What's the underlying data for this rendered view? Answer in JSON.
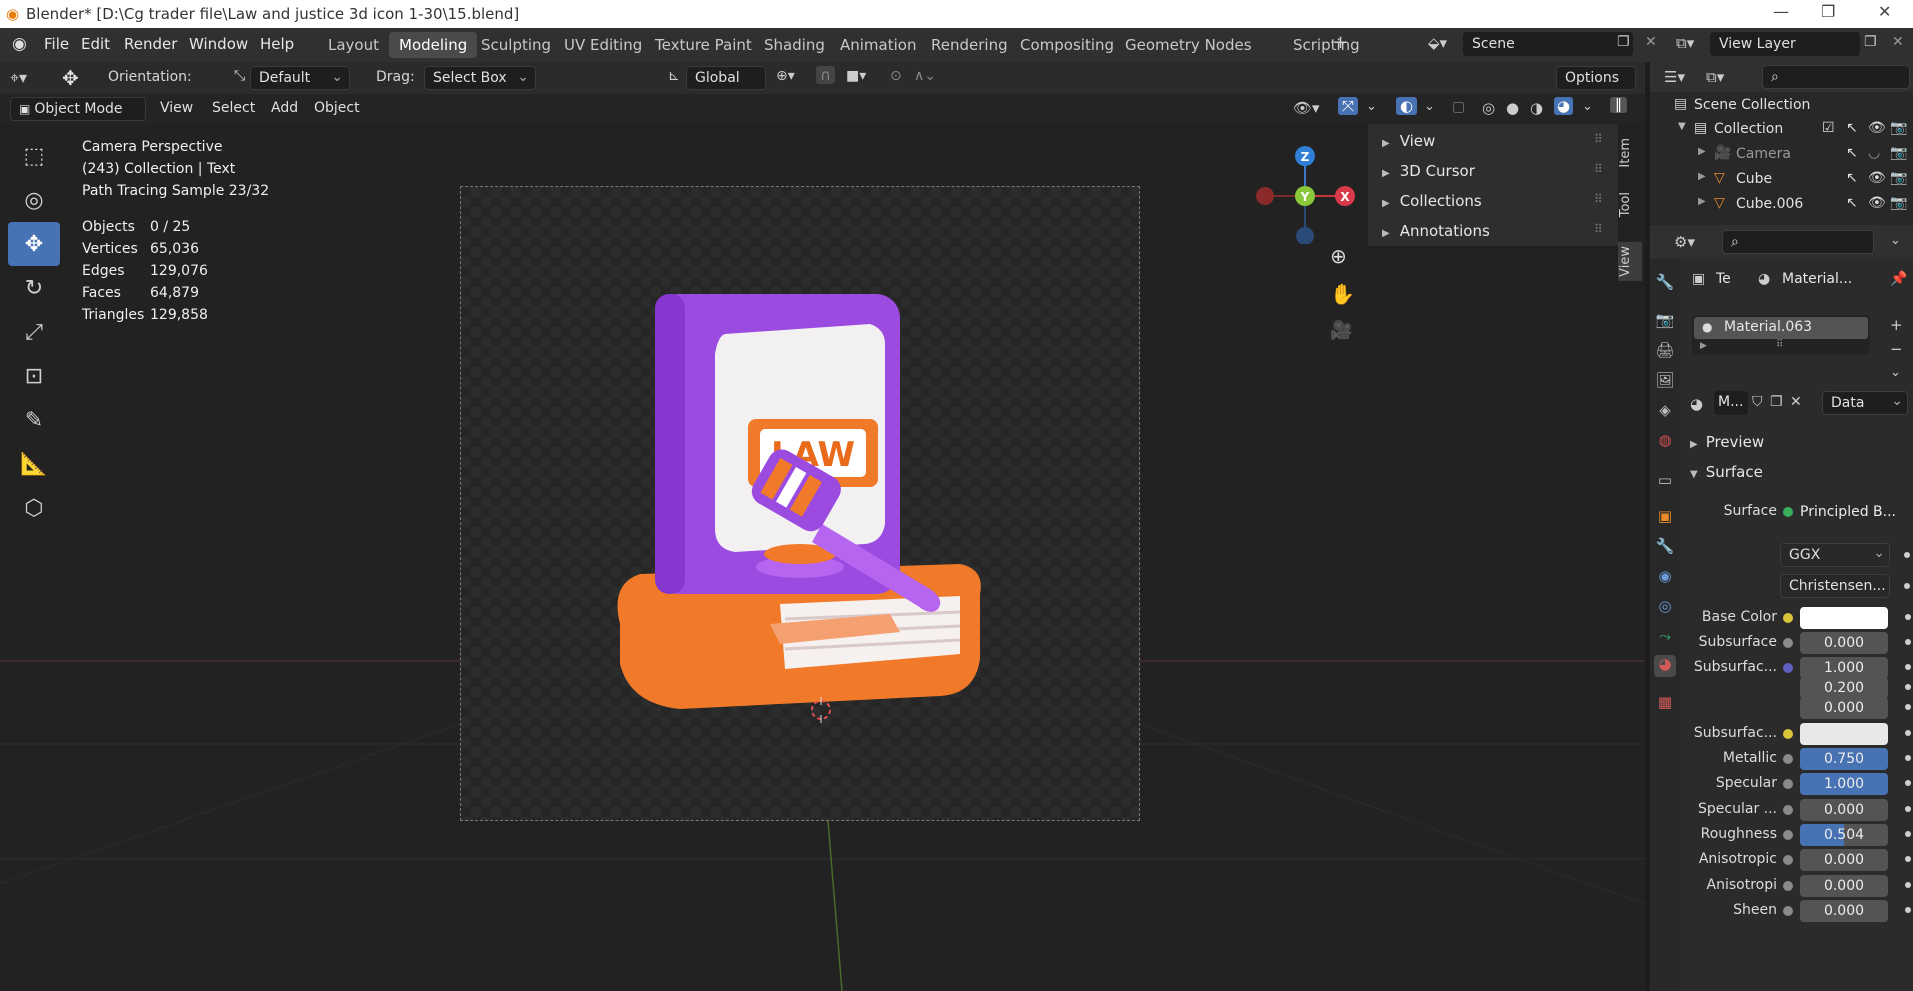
{
  "titlebar": {
    "title": "Blender* [D:\\Cg trader file\\Law and justice 3d icon 1-30\\15.blend]"
  },
  "menu": {
    "items": [
      "File",
      "Edit",
      "Render",
      "Window",
      "Help"
    ]
  },
  "workspaces": [
    "Layout",
    "Modeling",
    "Sculpting",
    "UV Editing",
    "Texture Paint",
    "Shading",
    "Animation",
    "Rendering",
    "Compositing",
    "Geometry Nodes",
    "Scripting"
  ],
  "scene": {
    "name": "Scene",
    "view_layer": "View Layer"
  },
  "toolheader": {
    "orientation_label": "Orientation:",
    "orientation_value": "Default",
    "drag_label": "Drag:",
    "drag_value": "Select Box",
    "transform_orientation": "Global",
    "options": "Options"
  },
  "viewheader": {
    "mode": "Object Mode",
    "menus": [
      "View",
      "Select",
      "Add",
      "Object"
    ]
  },
  "viewport": {
    "info_lines": [
      "Camera Perspective",
      "(243) Collection | Text",
      "Path Tracing Sample 23/32"
    ],
    "stats": [
      {
        "label": "Objects",
        "value": "0 / 25"
      },
      {
        "label": "Vertices",
        "value": "65,036"
      },
      {
        "label": "Edges",
        "value": "129,076"
      },
      {
        "label": "Faces",
        "value": "64,879"
      },
      {
        "label": "Triangles",
        "value": "129,858"
      }
    ],
    "book_label": "LAW",
    "gizmo": {
      "z": "Z",
      "y": "Y",
      "x": "X"
    }
  },
  "npanel": {
    "items": [
      "View",
      "3D Cursor",
      "Collections",
      "Annotations"
    ],
    "tabs": [
      "Item",
      "Tool",
      "View"
    ]
  },
  "outliner": {
    "root": "Scene Collection",
    "collection": "Collection",
    "objects": [
      "Camera",
      "Cube",
      "Cube.006"
    ]
  },
  "properties": {
    "header_te": "Te",
    "header_material": "Material...",
    "material_slot": "Material.063",
    "mat_short": "M...",
    "data_dropdown": "Data",
    "sections": {
      "preview": "Preview",
      "surface": "Surface"
    },
    "surface_label": "Surface",
    "surface_value": "Principled B...",
    "distribution": "GGX",
    "subsurface_method": "Christensen...",
    "rows": [
      {
        "label": "Base Color",
        "value": "",
        "kind": "white",
        "dot": "#d9c43a"
      },
      {
        "label": "Subsurface",
        "value": "0.000",
        "kind": "gray",
        "dot": "#8a8a8a"
      },
      {
        "label": "Subsurfac...",
        "value": "1.000",
        "kind": "gray",
        "dot": "#6060c0"
      },
      {
        "label": "",
        "value": "0.200",
        "kind": "gray",
        "dot": ""
      },
      {
        "label": "",
        "value": "0.000",
        "kind": "gray",
        "dot": ""
      },
      {
        "label": "Subsurfac...",
        "value": "",
        "kind": "light",
        "dot": "#d9c43a"
      },
      {
        "label": "Metallic",
        "value": "0.750",
        "kind": "blue",
        "dot": "#8a8a8a"
      },
      {
        "label": "Specular",
        "value": "1.000",
        "kind": "blue",
        "dot": "#8a8a8a"
      },
      {
        "label": "Specular ...",
        "value": "0.000",
        "kind": "gray",
        "dot": "#8a8a8a"
      },
      {
        "label": "Roughness",
        "value": "0.504",
        "kind": "half",
        "dot": "#8a8a8a"
      },
      {
        "label": "Anisotropic",
        "value": "0.000",
        "kind": "gray",
        "dot": "#8a8a8a"
      },
      {
        "label": "Anisotropi",
        "value": "0.000",
        "kind": "gray",
        "dot": "#8a8a8a"
      },
      {
        "label": "Sheen",
        "value": "0.000",
        "kind": "gray",
        "dot": "#8a8a8a"
      }
    ]
  },
  "colors": {
    "accent_blue": "#4772b3",
    "book_purple": "#9b4be0",
    "book_orange": "#f07a2a"
  }
}
